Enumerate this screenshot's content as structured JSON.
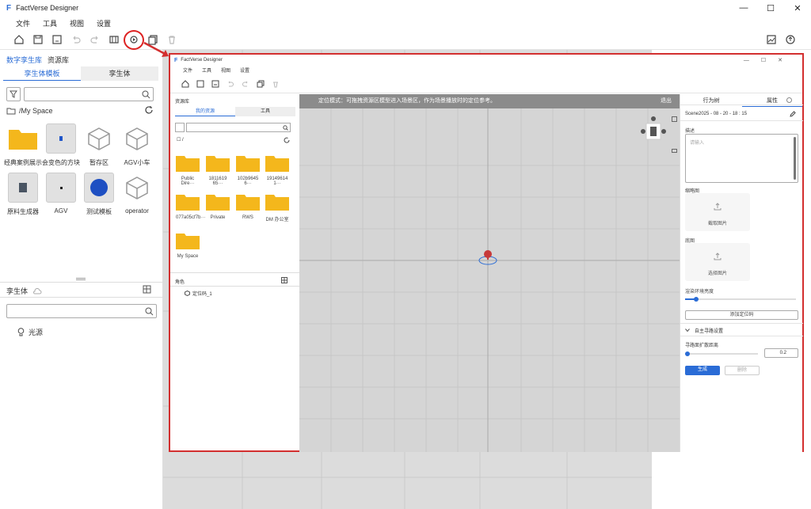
{
  "app": {
    "title": "FactVerse Designer",
    "logo": "F"
  },
  "menu": [
    "文件",
    "工具",
    "视图",
    "设置"
  ],
  "left": {
    "tabs": [
      "数字孪生库",
      "资源库"
    ],
    "subtabs": [
      "孪生体模板",
      "孪生体"
    ],
    "path": "/My Space",
    "assets": [
      {
        "label": "经典案例展示",
        "icon": "folder"
      },
      {
        "label": "会变色的方块",
        "icon": "cube-blue"
      },
      {
        "label": "暂存区",
        "icon": "box"
      },
      {
        "label": "AGV小车",
        "icon": "box"
      },
      {
        "label": "原料生成器",
        "icon": "machine"
      },
      {
        "label": "AGV",
        "icon": "agv"
      },
      {
        "label": "测试模板",
        "icon": "sphere"
      },
      {
        "label": "operator",
        "icon": "box"
      }
    ],
    "twin_section": "孪生体",
    "tree_items": [
      "光源"
    ]
  },
  "inner": {
    "title": "FactVerse Designer",
    "menu": [
      "文件",
      "工具",
      "视图",
      "设置"
    ],
    "resource_panel_title": "资源库",
    "resource_tabs": [
      "我的资源",
      "工具"
    ],
    "path": "/",
    "folders": [
      "Public Dire···",
      "1811619​65···",
      "102b9645​6···",
      "19149614​1···",
      "077a05cf7b···",
      "Private",
      "RWS",
      "DM 办公室",
      "My Space"
    ],
    "role_label": "角色",
    "role_items": [
      "定位码_1"
    ],
    "banner_text": "定位模式：可拖拽资源区模型进入场景区，作为场景播放时的定位参考。",
    "banner_exit": "退出",
    "right_tabs": [
      "行为树",
      "属性"
    ],
    "scene_name": "Scene2025 - 08 - 20 - 18 : 15",
    "desc_label": "描述",
    "desc_placeholder": "请输入",
    "thumb_label": "缩略图",
    "thumb_btn": "截取图片",
    "bottom_label": "底图",
    "bottom_btn": "选择图片",
    "render_label": "渲染环境亮度",
    "render_value": 0.1,
    "add_locator": "添加定位码",
    "nav_section": "自主寻路设置",
    "nav_label": "寻路面扩散距离",
    "nav_value": "0.2",
    "generate": "生成",
    "delete": "删除"
  },
  "colors": {
    "accent": "#2a6cd6",
    "highlight": "#d32f2f",
    "folder": "#f4b71c"
  }
}
